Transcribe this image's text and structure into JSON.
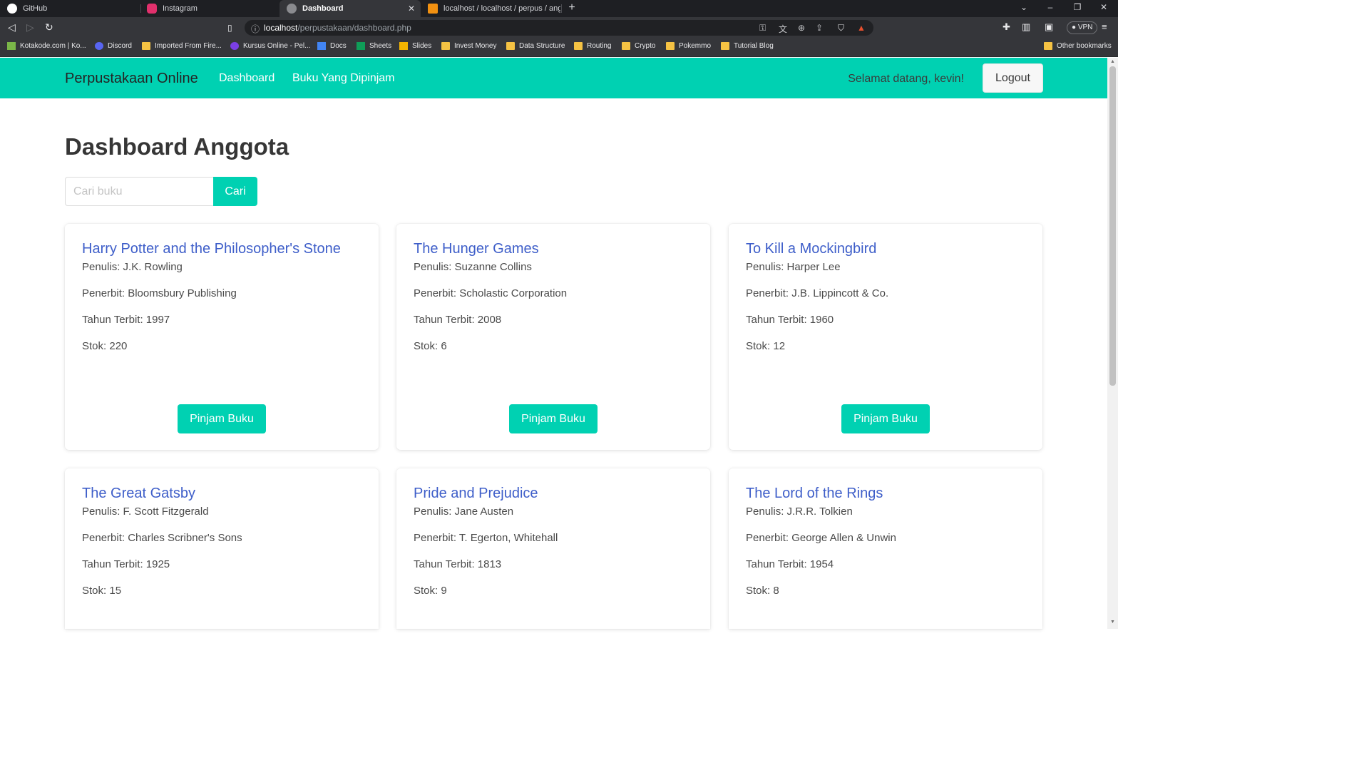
{
  "browser": {
    "tabs": [
      {
        "label": "GitHub",
        "active": false
      },
      {
        "label": "Instagram",
        "active": false
      },
      {
        "label": "Dashboard",
        "active": true
      },
      {
        "label": "localhost / localhost / perpus / anggota",
        "active": false
      }
    ],
    "url_host": "localhost",
    "url_path": "/perpustakaan/dashboard.php",
    "vpn_label": "VPN",
    "bookmarks": [
      "Kotakode.com | Ko...",
      "Discord",
      "Imported From Fire...",
      "Kursus Online - Pel...",
      "Docs",
      "Sheets",
      "Slides",
      "Invest Money",
      "Data Structure",
      "Routing",
      "Crypto",
      "Pokemmo",
      "Tutorial Blog"
    ],
    "other_bookmarks": "Other bookmarks"
  },
  "navbar": {
    "brand": "Perpustakaan Online",
    "links": [
      "Dashboard",
      "Buku Yang Dipinjam"
    ],
    "welcome": "Selamat datang, kevin!",
    "logout": "Logout",
    "color": "#00d1b2"
  },
  "main": {
    "title": "Dashboard Anggota",
    "search_placeholder": "Cari buku",
    "search_button": "Cari",
    "borrow_label": "Pinjam Buku",
    "books": [
      {
        "title": "Harry Potter and the Philosopher's Stone",
        "author": "Penulis: J.K. Rowling",
        "publisher": "Penerbit: Bloomsbury Publishing",
        "year": "Tahun Terbit: 1997",
        "stock": "Stok: 220"
      },
      {
        "title": "The Hunger Games",
        "author": "Penulis: Suzanne Collins",
        "publisher": "Penerbit: Scholastic Corporation",
        "year": "Tahun Terbit: 2008",
        "stock": "Stok: 6"
      },
      {
        "title": "To Kill a Mockingbird",
        "author": "Penulis: Harper Lee",
        "publisher": "Penerbit: J.B. Lippincott & Co.",
        "year": "Tahun Terbit: 1960",
        "stock": "Stok: 12"
      },
      {
        "title": "The Great Gatsby",
        "author": "Penulis: F. Scott Fitzgerald",
        "publisher": "Penerbit: Charles Scribner's Sons",
        "year": "Tahun Terbit: 1925",
        "stock": "Stok: 15"
      },
      {
        "title": "Pride and Prejudice",
        "author": "Penulis: Jane Austen",
        "publisher": "Penerbit: T. Egerton, Whitehall",
        "year": "Tahun Terbit: 1813",
        "stock": "Stok: 9"
      },
      {
        "title": "The Lord of the Rings",
        "author": "Penulis: J.R.R. Tolkien",
        "publisher": "Penerbit: George Allen & Unwin",
        "year": "Tahun Terbit: 1954",
        "stock": "Stok: 8"
      }
    ]
  }
}
